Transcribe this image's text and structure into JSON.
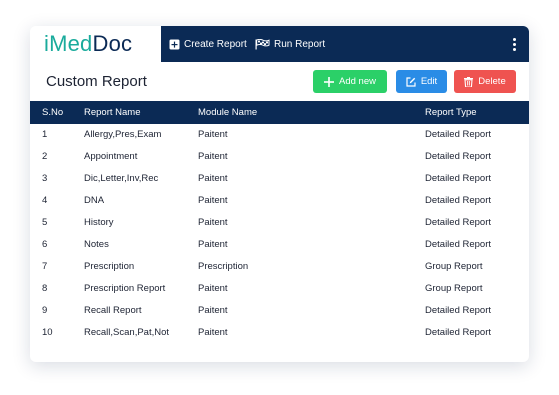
{
  "app": {
    "logo_prefix": "iMed",
    "logo_suffix": "Doc"
  },
  "nav": {
    "create_report": "Create Report",
    "run_report": "Run Report"
  },
  "page": {
    "title": "Custom Report"
  },
  "actions": {
    "add_label": "Add new",
    "edit_label": "Edit",
    "delete_label": "Delete"
  },
  "colors": {
    "navy": "#0b2a55",
    "brand_teal": "#1aab9c",
    "add_green": "#2bd068",
    "edit_blue": "#2a8ce6",
    "delete_red": "#ef5350"
  },
  "icons": {
    "create": "plus-square-icon",
    "run": "flag-icon",
    "menu": "kebab-menu-icon",
    "add": "plus-icon",
    "edit": "edit-icon",
    "delete": "trash-icon"
  },
  "table": {
    "columns": [
      "S.No",
      "Report Name",
      "Module Name",
      "Report Type"
    ],
    "rows": [
      [
        "1",
        "Allergy,Pres,Exam",
        "Paitent",
        "Detailed Report"
      ],
      [
        "2",
        "Appointment",
        "Paitent",
        "Detailed Report"
      ],
      [
        "3",
        "Dic,Letter,Inv,Rec",
        "Paitent",
        "Detailed Report"
      ],
      [
        "4",
        "DNA",
        "Paitent",
        "Detailed Report"
      ],
      [
        "5",
        "History",
        "Paitent",
        "Detailed Report"
      ],
      [
        "6",
        "Notes",
        "Paitent",
        "Detailed Report"
      ],
      [
        "7",
        "Prescription",
        "Prescription",
        "Group Report"
      ],
      [
        "8",
        "Prescription Report",
        "Paitent",
        "Group Report"
      ],
      [
        "9",
        "Recall Report",
        "Paitent",
        "Detailed Report"
      ],
      [
        "10",
        "Recall,Scan,Pat,Not",
        "Paitent",
        "Detailed Report"
      ]
    ]
  }
}
